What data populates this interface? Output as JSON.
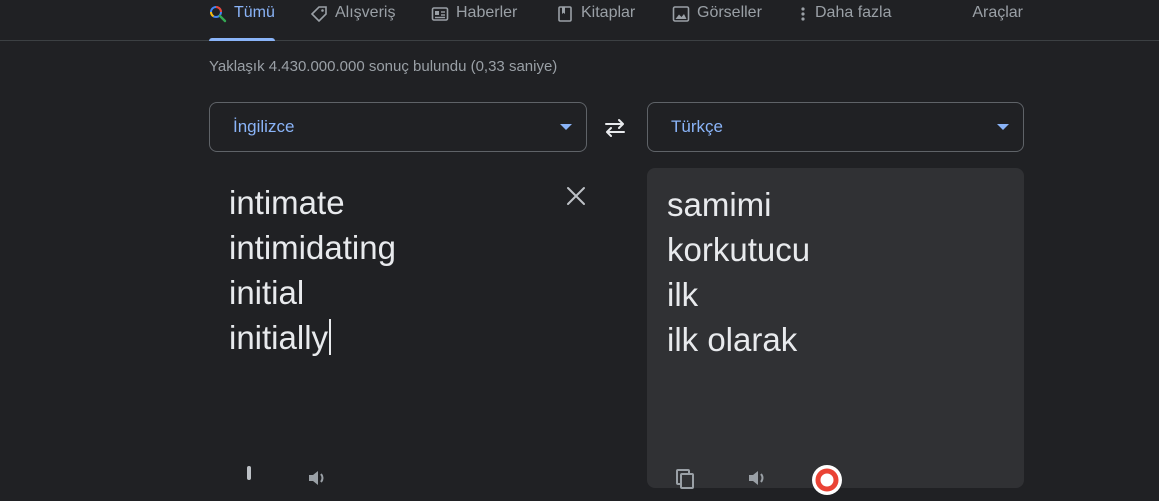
{
  "tabs": [
    {
      "label": "Tümü",
      "icon": "search-icon"
    },
    {
      "label": "Alışveriş",
      "icon": "tag-icon"
    },
    {
      "label": "Haberler",
      "icon": "newspaper-icon"
    },
    {
      "label": "Kitaplar",
      "icon": "book-icon"
    },
    {
      "label": "Görseller",
      "icon": "image-icon"
    },
    {
      "label": "Daha fazla",
      "icon": "more-vert-icon"
    }
  ],
  "tools_label": "Araçlar",
  "result_stats": "Yaklaşık 4.430.000.000 sonuç bulundu (0,33 saniye)",
  "translator": {
    "source_language": "İngilizce",
    "target_language": "Türkçe",
    "source_lines": [
      "intimate",
      "intimidating",
      "initial",
      "initially"
    ],
    "target_lines": [
      "samimi",
      "korkutucu",
      "ilk",
      "ilk olarak"
    ]
  },
  "colors": {
    "accent": "#8ab4f8",
    "background": "#202124",
    "panel": "#303134"
  }
}
